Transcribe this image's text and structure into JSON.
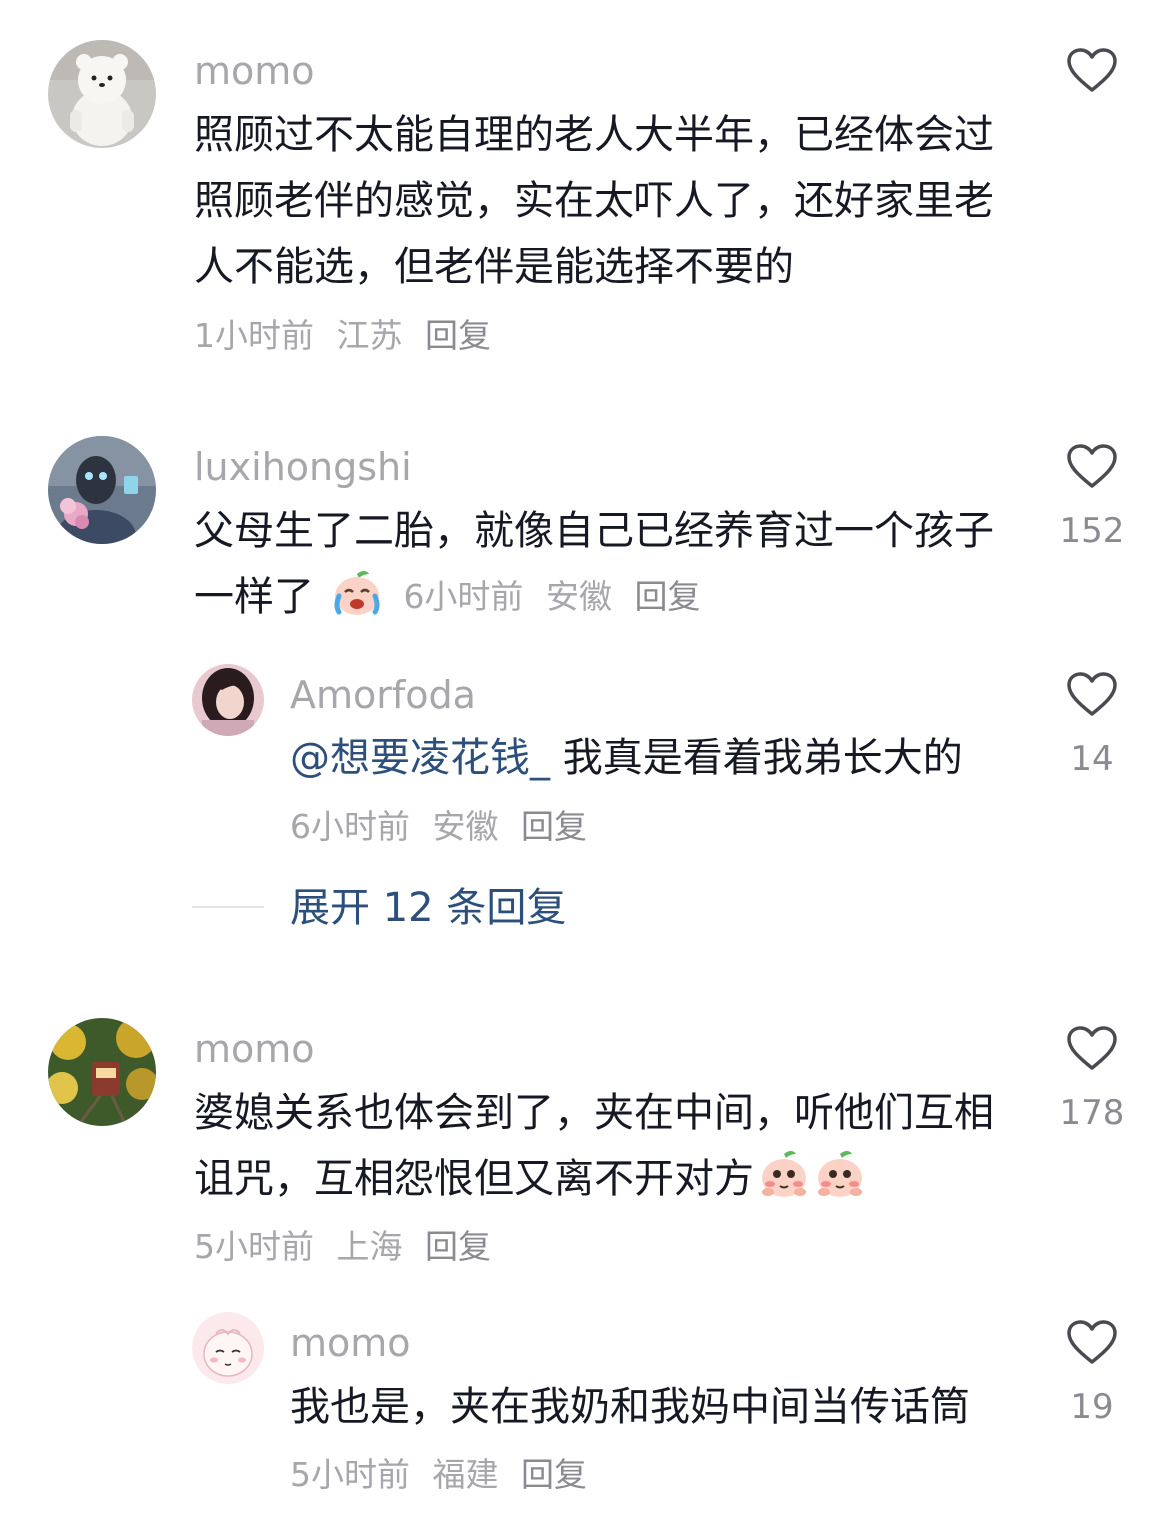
{
  "comments": [
    {
      "username": "momo",
      "content": "照顾过不太能自理的老人大半年，已经体会过照顾老伴的感觉，实在太吓人了，还好家里老人不能选，但老伴是能选择不要的",
      "time": "1小时前",
      "location": "江苏",
      "reply_label": "回复",
      "avatar": "white-bear-plush"
    },
    {
      "username": "luxihongshi",
      "content": "父母生了二胎，就像自己已经养育过一个孩子一样了",
      "emoji": "crying-peach-emoji",
      "time": "6小时前",
      "location": "安徽",
      "reply_label": "回复",
      "likes": "152",
      "avatar": "robot-with-flowers",
      "replies": [
        {
          "username": "Amorfoda",
          "mention": "@想要凌花钱_",
          "content": "我真是看着我弟长大的",
          "time": "6小时前",
          "location": "安徽",
          "reply_label": "回复",
          "likes": "14",
          "avatar": "girl-portrait"
        }
      ],
      "expand_label": "展开 12 条回复"
    },
    {
      "username": "momo",
      "content": "婆媳关系也体会到了，夹在中间，听他们互相诅咒，互相怨恨但又离不开对方",
      "emoji": "shy-peach-emoji",
      "time": "5小时前",
      "location": "上海",
      "reply_label": "回复",
      "likes": "178",
      "avatar": "train-flowers",
      "replies": [
        {
          "username": "momo",
          "content": "我也是，夹在我奶和我妈中间当传话筒",
          "time": "5小时前",
          "location": "福建",
          "reply_label": "回复",
          "likes": "19",
          "avatar": "pink-cartoon"
        }
      ]
    }
  ],
  "icons": {
    "like": "heart-outline-icon"
  },
  "colors": {
    "username": "#a6a6ab",
    "text": "#161823",
    "mention": "#2c4f7c",
    "meta": "#a6a6ab"
  }
}
